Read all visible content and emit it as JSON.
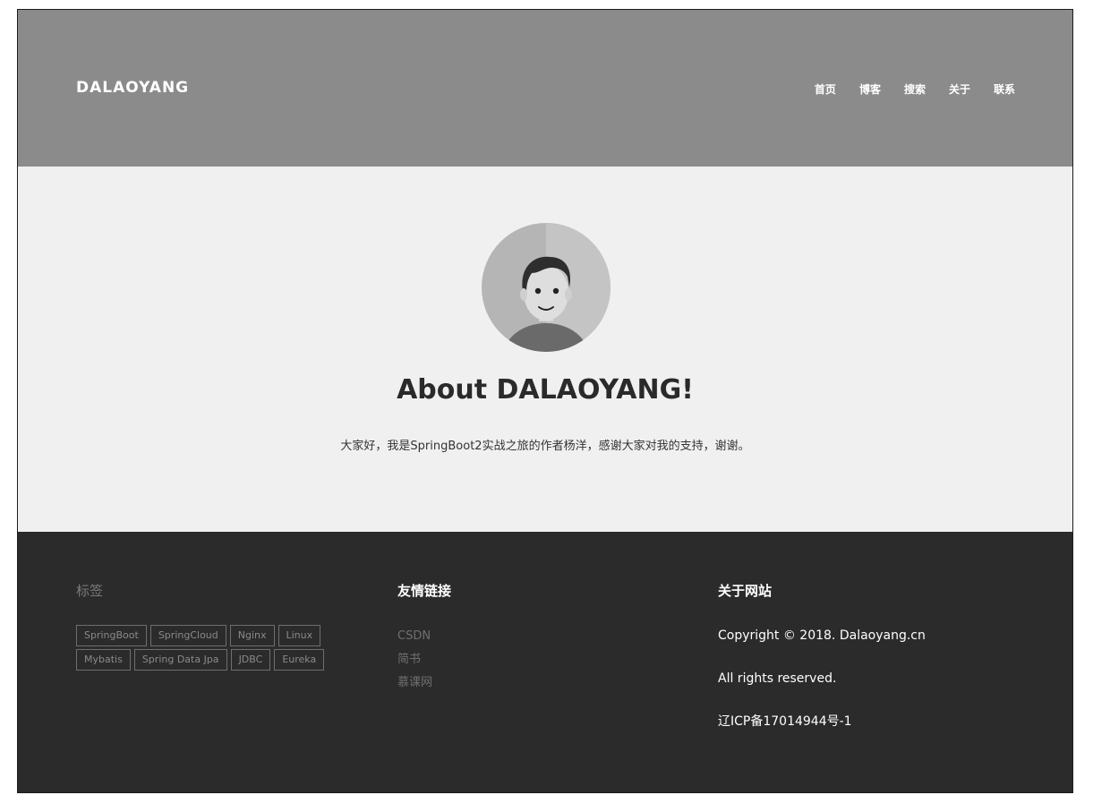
{
  "header": {
    "brand": "DALAOYANG",
    "nav": [
      "首页",
      "博客",
      "搜索",
      "关于",
      "联系"
    ]
  },
  "about": {
    "avatar_icon": "user-avatar-icon",
    "title": "About DALAOYANG!",
    "description": "大家好，我是SpringBoot2实战之旅的作者杨洋，感谢大家对我的支持，谢谢。"
  },
  "footer": {
    "tags_title": "标签",
    "tags": [
      "SpringBoot",
      "SpringCloud",
      "Nginx",
      "Linux",
      "Mybatis",
      "Spring Data Jpa",
      "JDBC",
      "Eureka"
    ],
    "links_title": "友情链接",
    "links": [
      "CSDN",
      "简书",
      "慕课网"
    ],
    "about_title": "关于网站",
    "about_lines": [
      "Copyright © 2018. Dalaoyang.cn",
      "All rights reserved.",
      "辽ICP备17014944号-1"
    ]
  },
  "colors": {
    "header_bg": "#8b8b8b",
    "about_bg": "#f0f0f0",
    "footer_bg": "#2b2b2b"
  }
}
